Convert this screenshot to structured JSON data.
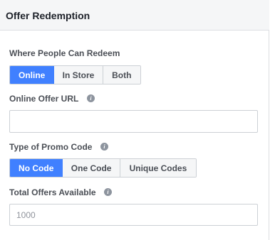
{
  "header": {
    "title": "Offer Redemption"
  },
  "redeem": {
    "label": "Where People Can Redeem",
    "options": [
      "Online",
      "In Store",
      "Both"
    ],
    "selected": "Online"
  },
  "url": {
    "label": "Online Offer URL",
    "value": "",
    "placeholder": ""
  },
  "promo": {
    "label": "Type of Promo Code",
    "options": [
      "No Code",
      "One Code",
      "Unique Codes"
    ],
    "selected": "No Code"
  },
  "total": {
    "label": "Total Offers Available",
    "value": "",
    "placeholder": "1000"
  },
  "icons": {
    "info": "info-icon"
  },
  "colors": {
    "accent": "#4080ff",
    "header_bg": "#f5f6f7",
    "border": "#ccd0d5"
  }
}
